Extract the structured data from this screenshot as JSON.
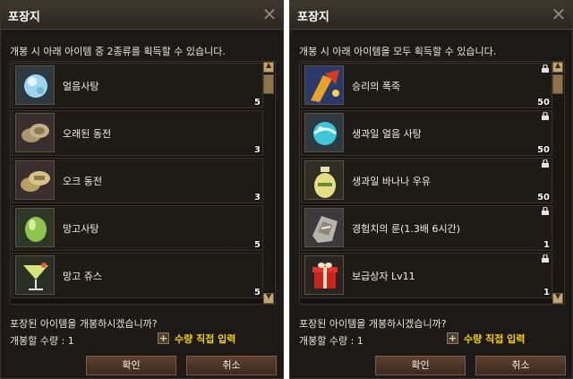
{
  "dialogs": [
    {
      "title": "포장지",
      "description": "개봉 시 아래 아이템 중 2종류를 획득할 수 있습니다.",
      "items": [
        {
          "name": "얼음사탕",
          "qty": "5",
          "icon": "ice-candy-icon",
          "locked": false
        },
        {
          "name": "오래된 동전",
          "qty": "3",
          "icon": "old-coin-icon",
          "locked": false
        },
        {
          "name": "오크 동전",
          "qty": "3",
          "icon": "orc-coin-icon",
          "locked": false
        },
        {
          "name": "망고사탕",
          "qty": "5",
          "icon": "mango-candy-icon",
          "locked": false
        },
        {
          "name": "망고 쥬스",
          "qty": "5",
          "icon": "mango-juice-icon",
          "locked": false
        }
      ],
      "question": "포장된 아이템을 개봉하시겠습니까?",
      "qty_label": "개봉할 수량 : 1",
      "direct_input_label": "수량 직접 입력",
      "ok_label": "확인",
      "cancel_label": "취소"
    },
    {
      "title": "포장지",
      "description": "개봉 시 아래 아이템을 모두 획득할 수 있습니다.",
      "items": [
        {
          "name": "승리의 폭죽",
          "qty": "50",
          "icon": "firecracker-icon",
          "locked": true
        },
        {
          "name": "생과일 얼음 사탕",
          "qty": "50",
          "icon": "ice-candy-icon",
          "locked": true
        },
        {
          "name": "생과일 바나나 우유",
          "qty": "50",
          "icon": "banana-milk-icon",
          "locked": true
        },
        {
          "name": "경험치의 룬(1.3배 6시간)",
          "qty": "1",
          "icon": "exp-rune-icon",
          "locked": true
        },
        {
          "name": "보급상자 Lv11",
          "qty": "1",
          "icon": "supply-box-icon",
          "locked": true
        }
      ],
      "question": "포장된 아이템을 개봉하시겠습니까?",
      "qty_label": "개봉할 수량 : 1",
      "direct_input_label": "수량 직접 입력",
      "ok_label": "확인",
      "cancel_label": "취소"
    }
  ],
  "close_icon": "close-icon",
  "colors": {
    "background": "#1c1916",
    "accent_yellow": "#f3d100",
    "button": "#5b4030",
    "scrollbar": "#c3a574"
  }
}
